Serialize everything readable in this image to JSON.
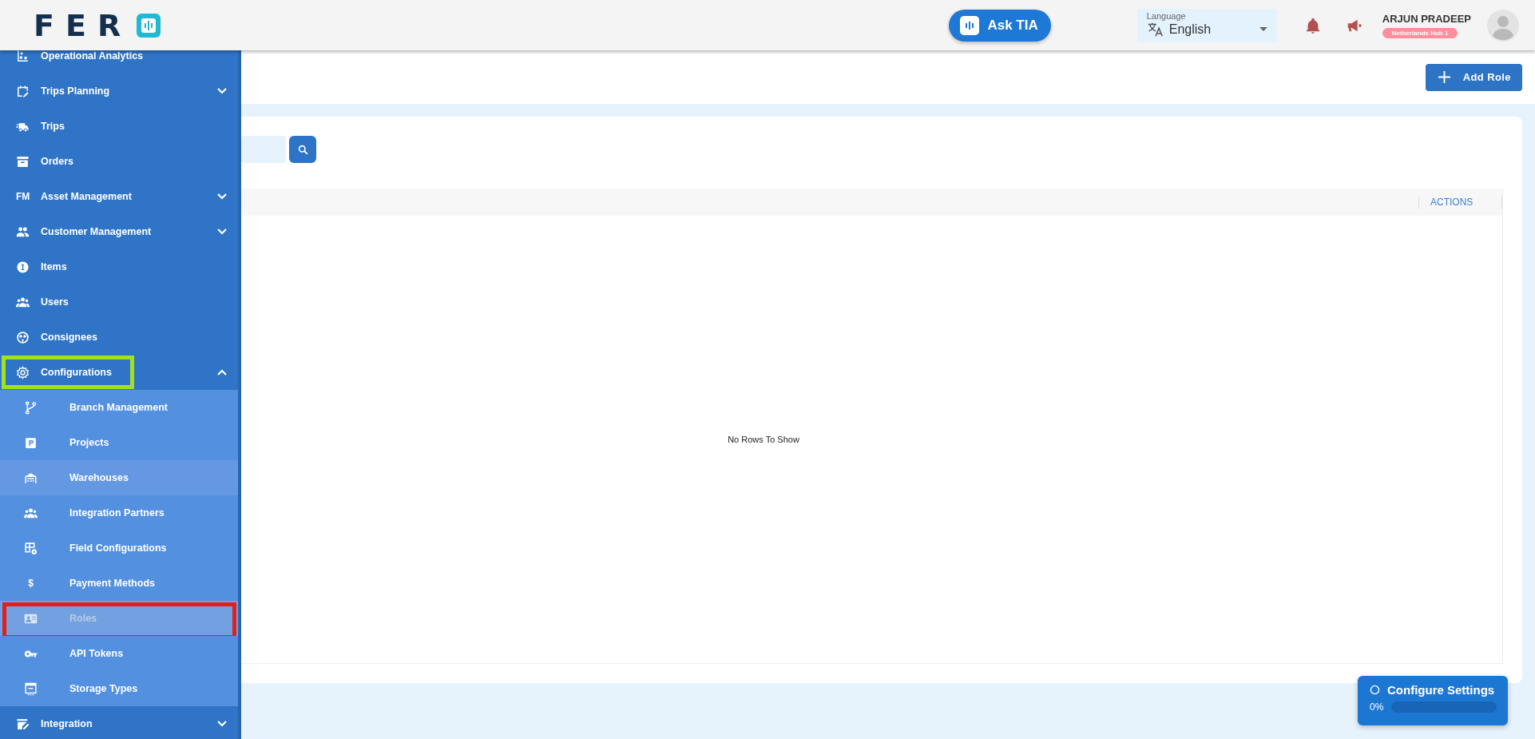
{
  "header": {
    "logo_text": "FER",
    "ask_button": "Ask TIA",
    "language": {
      "label": "Language",
      "value": "English"
    },
    "user": {
      "name": "ARJUN PRADEEP",
      "hub": "Netherlands Hub 1"
    }
  },
  "sidebar": {
    "items": [
      {
        "label": "Operational Analytics",
        "kind": "link"
      },
      {
        "label": "Trips Planning",
        "kind": "group",
        "expanded": false
      },
      {
        "label": "Trips",
        "kind": "link"
      },
      {
        "label": "Orders",
        "kind": "link"
      },
      {
        "label": "Asset Management",
        "kind": "group",
        "expanded": false,
        "icon_text": "FM"
      },
      {
        "label": "Customer Management",
        "kind": "group",
        "expanded": false
      },
      {
        "label": "Items",
        "kind": "link"
      },
      {
        "label": "Users",
        "kind": "link"
      },
      {
        "label": "Consignees",
        "kind": "link"
      },
      {
        "label": "Configurations",
        "kind": "group",
        "expanded": true,
        "color": "#a3e11c",
        "children": [
          {
            "label": "Branch Management",
            "selected": false,
            "hovered": false
          },
          {
            "label": "Projects",
            "selected": false,
            "hovered": false
          },
          {
            "label": "Warehouses",
            "selected": false,
            "hovered": true
          },
          {
            "label": "Integration Partners",
            "selected": false,
            "hovered": false
          },
          {
            "label": "Field Configurations",
            "selected": false,
            "hovered": false
          },
          {
            "label": "Payment Methods",
            "selected": false,
            "hovered": false,
            "icon_text": "$"
          },
          {
            "label": "Roles",
            "selected": true,
            "hovered": false,
            "color": "#e41e1e"
          },
          {
            "label": "API Tokens",
            "selected": false,
            "hovered": false
          },
          {
            "label": "Storage Types",
            "selected": false,
            "hovered": false
          }
        ]
      },
      {
        "label": "Integration",
        "kind": "group",
        "expanded": false
      }
    ]
  },
  "toolbar": {
    "add_button": "Add Role"
  },
  "table": {
    "columns": [
      {
        "label": "ACTIONS"
      }
    ],
    "empty_message": "No Rows To Show"
  },
  "setup_widget": {
    "title": "Configure Settings",
    "percent": "0%",
    "level": 0
  }
}
